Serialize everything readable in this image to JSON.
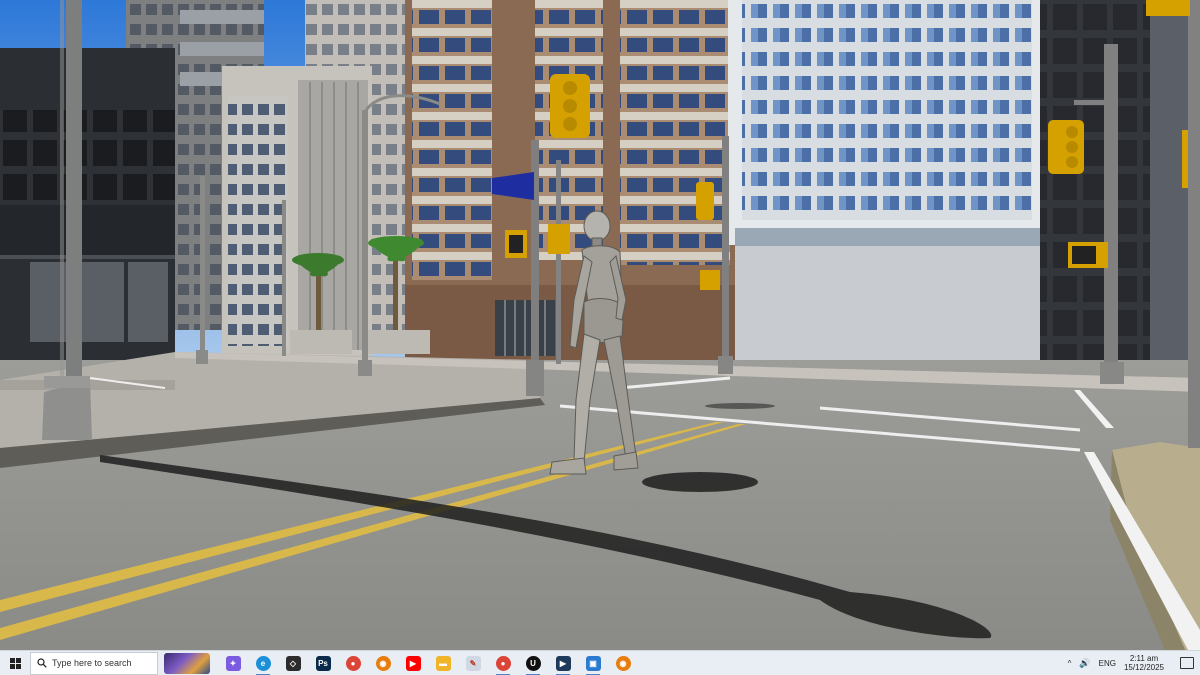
{
  "scene": {
    "description_name": "game-viewport"
  },
  "taskbar": {
    "search_placeholder": "Type here to search",
    "apps": [
      {
        "name": "copilot",
        "color": "#7b5be0",
        "glyph": "✦"
      },
      {
        "name": "edge",
        "color": "#1b8fd8",
        "glyph": "e"
      },
      {
        "name": "unity",
        "color": "#2c2c2c",
        "glyph": "◇"
      },
      {
        "name": "photoshop",
        "color": "#0b2a4a",
        "glyph": "Ps"
      },
      {
        "name": "chrome",
        "color": "#db4437",
        "glyph": "●"
      },
      {
        "name": "blender",
        "color": "#e87d0d",
        "glyph": "◉"
      },
      {
        "name": "youtube",
        "color": "#ff0000",
        "glyph": "▶"
      },
      {
        "name": "file-explorer",
        "color": "#f0b429",
        "glyph": "▬"
      },
      {
        "name": "paint",
        "color": "#cfd8e3",
        "glyph": "✎"
      },
      {
        "name": "chrome-2",
        "color": "#db4437",
        "glyph": "●"
      },
      {
        "name": "unreal-engine",
        "color": "#111111",
        "glyph": "U"
      },
      {
        "name": "media-player",
        "color": "#1e3a5a",
        "glyph": "▶"
      },
      {
        "name": "remote-desktop",
        "color": "#2a7ad0",
        "glyph": "▣"
      },
      {
        "name": "blender-2",
        "color": "#e87d0d",
        "glyph": "◉"
      }
    ],
    "tray": {
      "chevron": "^",
      "volume": "🔊",
      "language": "ENG",
      "time": "2:11 am",
      "date": "15/12/2025"
    }
  }
}
